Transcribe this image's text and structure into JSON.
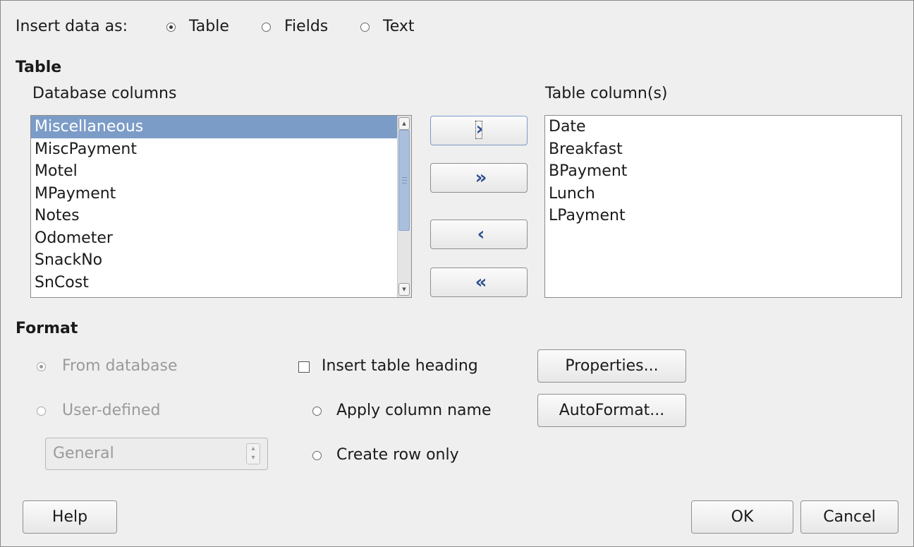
{
  "insert_as": {
    "label": "Insert data as:",
    "options": [
      {
        "label": "Table",
        "selected": true
      },
      {
        "label": "Fields",
        "selected": false
      },
      {
        "label": "Text",
        "selected": false
      }
    ]
  },
  "table_section": {
    "heading": "Table",
    "db_columns_label": "Database columns",
    "db_columns": [
      "Miscellaneous",
      "MiscPayment",
      "Motel",
      "MPayment",
      "Notes",
      "Odometer",
      "SnackNo",
      "SnCost"
    ],
    "db_selected": "Miscellaneous",
    "table_columns_label": "Table column(s)",
    "table_columns": [
      "Date",
      "Breakfast",
      "BPayment",
      "Lunch",
      "LPayment"
    ],
    "arrows": {
      "add_one": "›",
      "add_all": "»",
      "remove_one": "‹",
      "remove_all": "«"
    }
  },
  "format_section": {
    "heading": "Format",
    "from_database": "From database",
    "user_defined": "User-defined",
    "format_value": "General",
    "insert_heading": "Insert table heading",
    "apply_column_name": "Apply column name",
    "create_row_only": "Create row only",
    "properties_button": "Properties...",
    "autoformat_button": "AutoFormat..."
  },
  "footer": {
    "help_button": "Help",
    "ok_button": "OK",
    "cancel_button": "Cancel"
  },
  "colors": {
    "selection": "#7c9cc8",
    "background": "#efefef",
    "arrow": "#2f4f8f"
  }
}
